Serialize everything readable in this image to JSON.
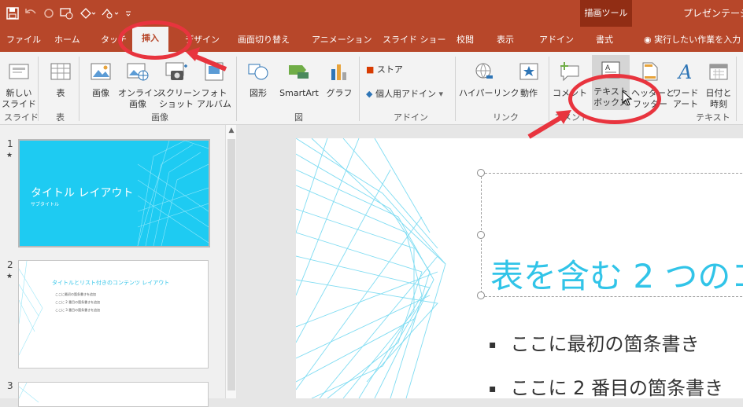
{
  "context_tab_group": "描画ツール",
  "app_title": "プレゼンテーシ",
  "tabs": [
    {
      "label": "ファイル"
    },
    {
      "label": "ホーム"
    },
    {
      "label": "タッチ"
    },
    {
      "label": "挿入"
    },
    {
      "label": "デザイン"
    },
    {
      "label": "画面切り替え"
    },
    {
      "label": "アニメーション"
    },
    {
      "label": "スライド ショー"
    },
    {
      "label": "校閲"
    },
    {
      "label": "表示"
    },
    {
      "label": "アドイン"
    },
    {
      "label": "書式"
    }
  ],
  "tell_me": "実行したい作業を入力",
  "ribbon": {
    "new_slide": "新しい\nスライド",
    "table": "表",
    "image": "画像",
    "online_image": "オンライン\n画像",
    "screenshot": "スクリーン\nショット",
    "photo_album": "フォト\nアルバム",
    "shapes": "図形",
    "smartart": "SmartArt",
    "graph": "グラフ",
    "store": "ストア",
    "personal_addins": "個人用アドイン",
    "hyperlink": "ハイパーリンク",
    "action": "動作",
    "comment": "コメント",
    "text_box": "テキスト\nボックス",
    "header_footer": "ヘッダーと\nフッター",
    "word_art": "ワード\nアート",
    "date_time": "日付と\n時刻",
    "groups": {
      "slide": "スライド",
      "table": "表",
      "image": "画像",
      "figure": "図",
      "addin": "アドイン",
      "link": "リンク",
      "comment": "コメント",
      "text": "テキスト"
    }
  },
  "thumbnails": [
    {
      "num": "1",
      "title": "タイトル レイアウト",
      "subtitle": "サブタイトル"
    },
    {
      "num": "2",
      "title": "タイトルとリスト付きのコンテンツ レイアウト",
      "bullets": [
        "ここに最初の箇条書きを追加",
        "ここに 2 番目の箇条書きを追加",
        "ここに 3 番目の箇条書きを追加"
      ]
    },
    {
      "num": "3"
    }
  ],
  "slide": {
    "title": "表を含む 2 つのコ",
    "bullets": [
      "ここに最初の箇条書き",
      "ここに 2 番目の箇条書き"
    ]
  },
  "colors": {
    "accent": "#b7472a",
    "context": "#912d14",
    "title_cyan": "#31c4e8",
    "annotation_red": "#e8343e"
  }
}
